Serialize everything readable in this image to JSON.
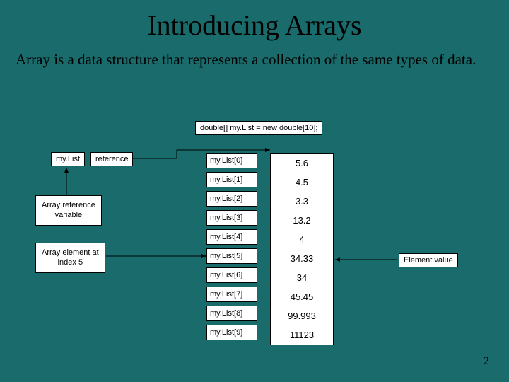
{
  "title": "Introducing Arrays",
  "subtitle": "Array is a data structure that represents a collection of the same types of data.",
  "decl": "double[] my.List = new double[10];",
  "mylist": "my.List",
  "reference": "reference",
  "arrvar_l1": "Array reference",
  "arrvar_l2": "variable",
  "elem5_l1": "Array element at",
  "elem5_l2": "index 5",
  "elemval": "Element value",
  "idx": [
    "my.List[0]",
    "my.List[1]",
    "my.List[2]",
    "my.List[3]",
    "my.List[4]",
    "my.List[5]",
    "my.List[6]",
    "my.List[7]",
    "my.List[8]",
    "my.List[9]"
  ],
  "vals": [
    "5.6",
    "4.5",
    "3.3",
    "13.2",
    "4",
    "34.33",
    "34",
    "45.45",
    "99.993",
    "11123"
  ],
  "page": "2"
}
